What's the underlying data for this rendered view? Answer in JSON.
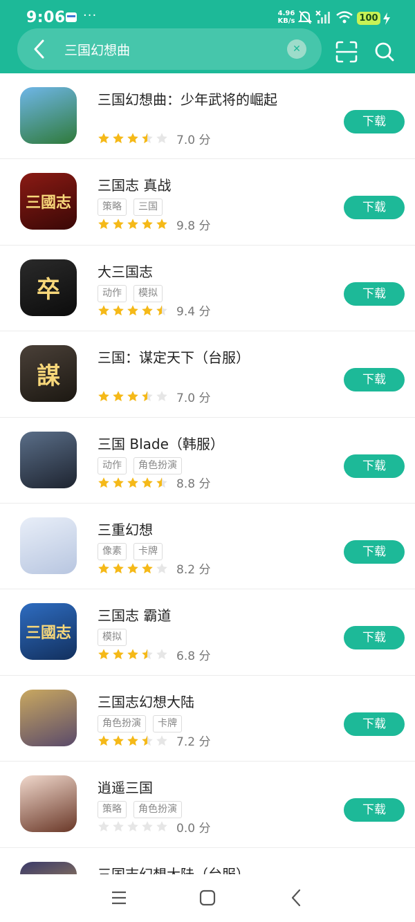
{
  "status_bar": {
    "time": "9:06",
    "net_speed_value": "4.96",
    "net_speed_unit": "KB/s",
    "battery": "100",
    "icons": [
      "card-icon",
      "more-dots-icon",
      "mute-icon",
      "signal-icon",
      "wifi-icon",
      "charging-icon"
    ]
  },
  "search": {
    "query": "三国幻想曲",
    "icons": [
      "back-icon",
      "clear-icon",
      "scan-icon",
      "search-icon"
    ]
  },
  "colors": {
    "accent": "#1db998",
    "search_bg": "#46c6ab",
    "star_on": "#f5b918",
    "star_off": "#e6e6e6",
    "battery": "#c8f255"
  },
  "apps": [
    {
      "name": "三国幻想曲：少年武将的崛起",
      "tags": [],
      "stars": 3.5,
      "score": "7.0 分",
      "button": "下载",
      "icon_colors": [
        "#6fb6e8",
        "#2f7a3a"
      ],
      "icon_text": ""
    },
    {
      "name": "三国志 真战",
      "tags": [
        "策略",
        "三国"
      ],
      "stars": 5,
      "score": "9.8 分",
      "button": "下载",
      "icon_colors": [
        "#8a1a14",
        "#3a0806"
      ],
      "icon_text": "三國志"
    },
    {
      "name": "大三国志",
      "tags": [
        "动作",
        "模拟"
      ],
      "stars": 4.5,
      "score": "9.4 分",
      "button": "下载",
      "icon_colors": [
        "#2a2a2a",
        "#0c0c0c"
      ],
      "icon_text": "卒"
    },
    {
      "name": "三国：谋定天下（台服）",
      "tags": [],
      "stars": 3.5,
      "score": "7.0 分",
      "button": "下载",
      "icon_colors": [
        "#4a4038",
        "#1c1812"
      ],
      "icon_text": "謀"
    },
    {
      "name": "三国 Blade（韩服）",
      "tags": [
        "动作",
        "角色扮演"
      ],
      "stars": 4.5,
      "score": "8.8 分",
      "button": "下载",
      "icon_colors": [
        "#5a6e88",
        "#1e2430"
      ],
      "icon_text": ""
    },
    {
      "name": "三重幻想",
      "tags": [
        "像素",
        "卡牌"
      ],
      "stars": 4,
      "score": "8.2 分",
      "button": "下载",
      "icon_colors": [
        "#e8eef8",
        "#b8c6e0"
      ],
      "icon_text": ""
    },
    {
      "name": "三国志 霸道",
      "tags": [
        "模拟"
      ],
      "stars": 3.5,
      "score": "6.8 分",
      "button": "下载",
      "icon_colors": [
        "#2e6cc0",
        "#12305e"
      ],
      "icon_text": "三國志"
    },
    {
      "name": "三国志幻想大陆",
      "tags": [
        "角色扮演",
        "卡牌"
      ],
      "stars": 3.5,
      "score": "7.2 分",
      "button": "下载",
      "icon_colors": [
        "#c9a860",
        "#5a4a6a"
      ],
      "icon_text": ""
    },
    {
      "name": "逍遥三国",
      "tags": [
        "策略",
        "角色扮演"
      ],
      "stars": 0,
      "score": "0.0 分",
      "button": "下载",
      "icon_colors": [
        "#f0d8cc",
        "#6a3828"
      ],
      "icon_text": ""
    },
    {
      "name": "三国志幻想大陆（台服）",
      "tags": [],
      "stars": 0,
      "score": "",
      "button": "",
      "icon_colors": [
        "#3a3a6a",
        "#c8a050"
      ],
      "icon_text": ""
    }
  ],
  "nav": {
    "icons": [
      "menu-icon",
      "home-icon",
      "back-nav-icon"
    ]
  }
}
